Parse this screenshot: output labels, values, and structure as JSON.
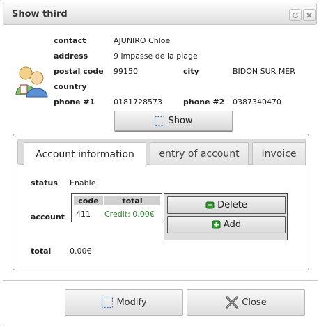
{
  "window": {
    "title": "Show third"
  },
  "contact": {
    "contact_label": "contact",
    "contact_value": "AJUNIRO Chloe",
    "address_label": "address",
    "address_value": "9 impasse de la plage",
    "postal_code_label": "postal code",
    "postal_code_value": "99150",
    "city_label": "city",
    "city_value": "BIDON SUR MER",
    "country_label": "country",
    "country_value": "",
    "phone1_label": "phone #1",
    "phone1_value": "0181728573",
    "phone2_label": "phone #2",
    "phone2_value": "0387340470",
    "show_button": "Show"
  },
  "tabs": [
    {
      "label": "Account information",
      "active": true
    },
    {
      "label": "entry of account",
      "active": false
    },
    {
      "label": "Invoice",
      "active": false
    }
  ],
  "account_info": {
    "status_label": "status",
    "status_value": "Enable",
    "account_label": "account",
    "table_headers": [
      "code",
      "total"
    ],
    "rows": [
      {
        "code": "411",
        "total": "Credit: 0.00€"
      }
    ],
    "delete_button": "Delete",
    "add_button": "Add",
    "total_label": "total",
    "total_value": "0.00€"
  },
  "footer": {
    "modify_button": "Modify",
    "close_button": "Close"
  },
  "colors": {
    "credit_text": "#2e8b2e",
    "icon_green": "#2a9a2a"
  }
}
